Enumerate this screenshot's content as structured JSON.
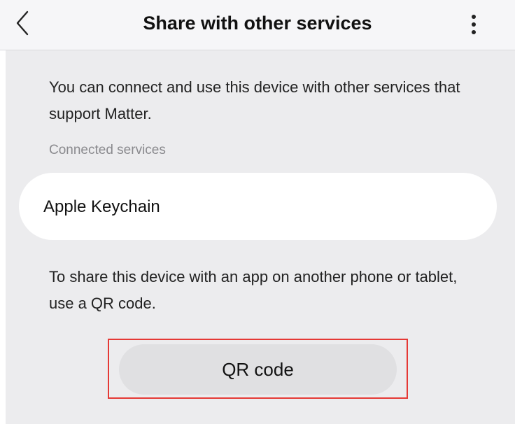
{
  "header": {
    "title": "Share with other services",
    "back_icon": "chevron-left-icon",
    "more_icon": "more-vertical-icon"
  },
  "main": {
    "description": "You can connect and use this device with other services that support Matter.",
    "section_label": "Connected services",
    "services": [
      {
        "name": "Apple Keychain"
      }
    ],
    "share_text": "To share this device with an app on another phone or tablet, use a QR code.",
    "qr_button_label": "QR code"
  },
  "colors": {
    "header_background": "#f6f6f8",
    "content_background": "#ececee",
    "card_background": "#ffffff",
    "button_background": "#e0e0e2",
    "highlight": "#e53935"
  }
}
